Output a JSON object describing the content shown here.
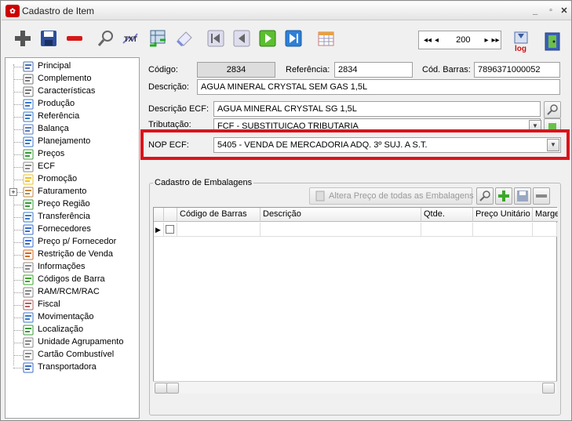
{
  "window": {
    "title": "Cadastro de Item",
    "app_icon": "app-icon",
    "min": "_",
    "max": "▫",
    "close": "✕"
  },
  "toolbar": {
    "icons": [
      "add-icon",
      "save-icon",
      "delete-icon",
      "search-icon",
      "txt-export-icon",
      "refresh-icon",
      "clear-icon",
      "first-record-icon",
      "previous-record-icon",
      "next-record-icon",
      "last-record-icon",
      "calendar-grid-icon",
      "log-icon",
      "exit-icon"
    ],
    "txt_label": "TXT",
    "log_label": "log",
    "nav": {
      "first": "◂◂",
      "prev": "◂",
      "value": "200",
      "next": "▸",
      "last": "▸▸"
    }
  },
  "sidebar": {
    "items": [
      {
        "label": "Principal",
        "icon": "list-icon"
      },
      {
        "label": "Complemento",
        "icon": "paperclip-icon"
      },
      {
        "label": "Características",
        "icon": "paperclip-icon"
      },
      {
        "label": "Produção",
        "icon": "production-icon"
      },
      {
        "label": "Referência",
        "icon": "reference-icon"
      },
      {
        "label": "Balança",
        "icon": "scale-icon"
      },
      {
        "label": "Planejamento",
        "icon": "planning-icon"
      },
      {
        "label": "Preços",
        "icon": "money-icon"
      },
      {
        "label": "ECF",
        "icon": "printer-icon"
      },
      {
        "label": "Promoção",
        "icon": "star-icon"
      },
      {
        "label": "Faturamento",
        "icon": "billing-icon",
        "expandable": true
      },
      {
        "label": "Preço Região",
        "icon": "region-icon"
      },
      {
        "label": "Transferência",
        "icon": "transfer-icon"
      },
      {
        "label": "Fornecedores",
        "icon": "suppliers-icon"
      },
      {
        "label": "Preço p/ Fornecedor",
        "icon": "supplier-price-icon"
      },
      {
        "label": "Restrição de Venda",
        "icon": "restriction-icon"
      },
      {
        "label": "Informações",
        "icon": "info-doc-icon"
      },
      {
        "label": "Códigos de Barra",
        "icon": "barcode-icon"
      },
      {
        "label": "RAM/RCM/RAC",
        "icon": "doc-icon"
      },
      {
        "label": "Fiscal",
        "icon": "fiscal-icon"
      },
      {
        "label": "Movimentação",
        "icon": "movement-icon"
      },
      {
        "label": "Localização",
        "icon": "location-icon"
      },
      {
        "label": "Unidade Agrupamento",
        "icon": "unit-icon"
      },
      {
        "label": "Cartão Combustível",
        "icon": "fuel-card-icon"
      },
      {
        "label": "Transportadora",
        "icon": "truck-icon"
      }
    ]
  },
  "form": {
    "codigo_label": "Código:",
    "codigo_value": "2834",
    "referencia_label": "Referência:",
    "referencia_value": "2834",
    "cod_barras_label": "Cód. Barras:",
    "cod_barras_value": "7896371000052",
    "descricao_label": "Descrição:",
    "descricao_value": "AGUA MINERAL CRYSTAL SEM GAS 1,5L",
    "descricao_ecf_label": "Descrição ECF:",
    "descricao_ecf_value": "AGUA MINERAL CRYSTAL SG 1,5L",
    "tributacao_label": "Tributação:",
    "tributacao_value": "FCF - SUBSTITUICAO TRIBUTARIA",
    "nop_label": "NOP ECF:",
    "nop_value": "5405 - VENDA DE MERCADORIA ADQ. 3º SUJ. A S.T."
  },
  "embalagens": {
    "group_title": "Cadastro de Embalagens",
    "altera_button": "Altera Preço de todas as Embalagens",
    "columns": [
      "Código de Barras",
      "Descrição",
      "Qtde.",
      "Preço Unitário",
      "Marge"
    ]
  }
}
